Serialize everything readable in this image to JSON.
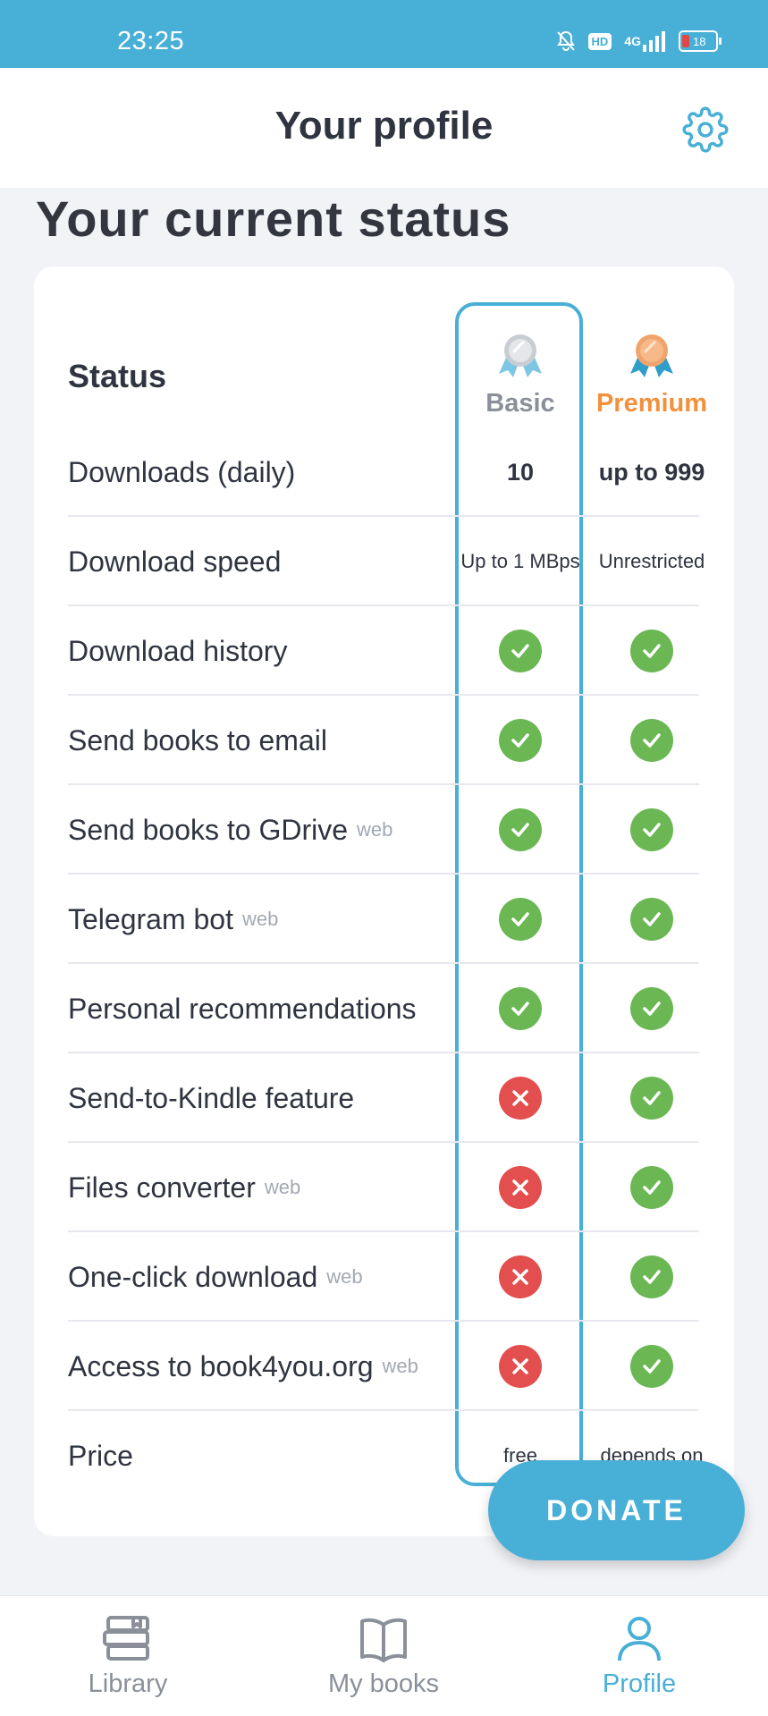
{
  "status_bar": {
    "time": "23:25",
    "hd": "HD",
    "network": "4G",
    "battery": "18"
  },
  "header": {
    "title": "Your profile"
  },
  "section": {
    "title": "Your current status"
  },
  "table": {
    "status_label": "Status",
    "tiers": [
      {
        "name": "Basic",
        "icon": "silver-medal-icon"
      },
      {
        "name": "Premium",
        "icon": "bronze-medal-icon"
      }
    ],
    "rows": [
      {
        "label": "Downloads (daily)",
        "web": "",
        "basic": "10",
        "premium": "up to 999"
      },
      {
        "label": "Download speed",
        "web": "",
        "basic": "Up to 1 MBps",
        "premium": "Unrestricted"
      },
      {
        "label": "Download history",
        "web": "",
        "basic": "check",
        "premium": "check"
      },
      {
        "label": "Send books to email",
        "web": "",
        "basic": "check",
        "premium": "check"
      },
      {
        "label": "Send books to GDrive",
        "web": "web",
        "basic": "check",
        "premium": "check"
      },
      {
        "label": "Telegram bot",
        "web": "web",
        "basic": "check",
        "premium": "check"
      },
      {
        "label": "Personal recommendations",
        "web": "",
        "basic": "check",
        "premium": "check"
      },
      {
        "label": "Send-to-Kindle feature",
        "web": "",
        "basic": "cross",
        "premium": "check"
      },
      {
        "label": "Files converter",
        "web": "web",
        "basic": "cross",
        "premium": "check"
      },
      {
        "label": "One-click download",
        "web": "web",
        "basic": "cross",
        "premium": "check"
      },
      {
        "label": "Access to book4you.org",
        "web": "web",
        "basic": "cross",
        "premium": "check"
      },
      {
        "label": "Price",
        "web": "",
        "basic": "free",
        "premium": "depends on"
      }
    ]
  },
  "donate": {
    "label": "DONATE"
  },
  "bottom_nav": {
    "items": [
      {
        "label": "Library",
        "icon": "library-icon"
      },
      {
        "label": "My books",
        "icon": "book-icon"
      },
      {
        "label": "Profile",
        "icon": "profile-icon"
      }
    ],
    "active": "Profile"
  },
  "colors": {
    "accent": "#48afd6",
    "check": "#6ab753",
    "cross": "#e34e4e",
    "premium": "#f2913d",
    "basic": "#8a8f99"
  }
}
